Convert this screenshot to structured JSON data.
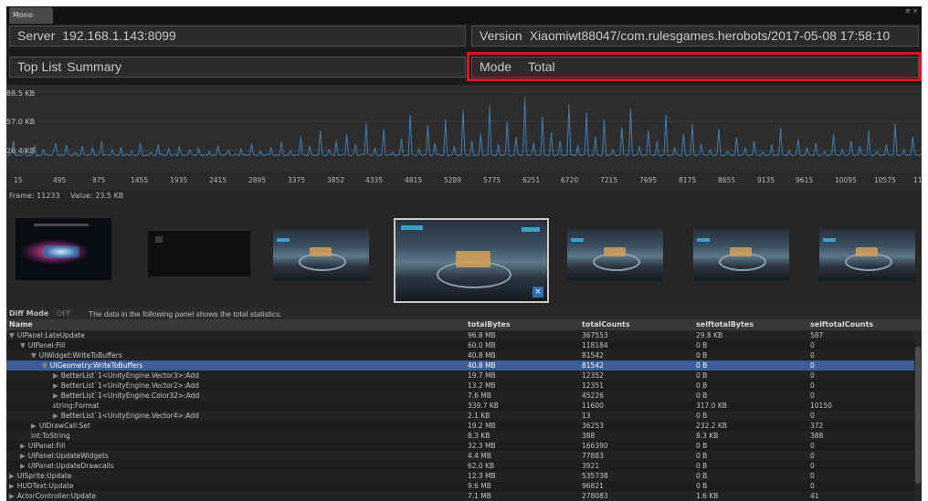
{
  "window": {
    "tab_title": "Mono",
    "buttons": "≡ ×"
  },
  "server": {
    "label": "Server",
    "value": "192.168.1.143:8099"
  },
  "version": {
    "label": "Version",
    "value": "Xiaomiwt88047/com.rulesgames.herobots/2017-05-08 17:58:10"
  },
  "toplist": {
    "label": "Top List",
    "value": "Summary"
  },
  "mode": {
    "label": "Mode",
    "value": "Total"
  },
  "chart_data": {
    "type": "line",
    "title": "",
    "ylabels": [
      "88.5 KB",
      "57.0 KB",
      "26.4 KB"
    ],
    "ylim": [
      0,
      88.5
    ],
    "x_ticks": [
      "15",
      "495",
      "975",
      "1455",
      "1935",
      "2415",
      "2895",
      "3375",
      "3852",
      "4335",
      "4815",
      "5289",
      "5775",
      "6251",
      "6720",
      "7215",
      "7695",
      "8175",
      "8655",
      "9135",
      "9615",
      "10095",
      "10575",
      "110"
    ],
    "line_color": "#3f7fb3",
    "values": [
      14,
      13,
      14,
      18,
      30,
      14,
      13,
      15,
      13,
      14,
      22,
      14,
      13,
      14,
      13,
      16,
      25,
      13,
      14,
      13,
      14,
      20,
      14,
      15,
      14,
      13,
      14,
      19,
      27,
      14,
      13,
      15,
      13,
      14,
      25,
      15,
      14,
      13,
      14,
      17,
      14,
      13,
      14,
      24,
      15,
      14,
      13,
      14,
      15,
      22,
      14,
      13,
      14,
      16,
      30,
      13,
      14,
      15,
      13,
      14,
      20,
      15,
      14,
      13,
      14,
      23,
      13,
      14,
      15,
      14,
      13,
      18,
      14,
      13,
      14,
      15,
      28,
      14,
      13,
      14,
      13,
      15,
      17,
      14,
      13,
      14,
      26,
      14,
      15,
      14,
      13,
      14,
      21,
      14,
      13,
      15,
      14,
      13,
      24,
      16,
      14,
      13,
      14,
      14,
      20,
      15,
      14,
      13,
      14,
      22,
      14,
      13,
      14,
      15,
      13,
      18,
      14,
      13,
      14,
      14,
      25,
      15,
      14,
      13,
      14,
      16,
      19,
      14,
      13,
      14,
      15,
      14,
      13,
      21,
      14,
      15,
      13,
      14,
      14,
      27,
      15,
      14,
      13,
      14,
      18,
      14,
      13,
      14,
      15,
      14,
      23,
      14,
      13,
      14,
      13,
      15,
      29,
      14,
      13,
      14,
      14,
      19,
      15,
      13,
      14,
      14,
      14,
      35,
      15,
      14,
      13,
      14,
      24,
      15,
      14,
      13,
      14,
      14,
      42,
      16,
      14,
      13,
      14,
      20,
      15,
      14,
      13,
      30,
      14,
      13,
      14,
      15,
      14,
      38,
      14,
      13,
      14,
      16,
      26,
      14,
      13,
      14,
      15,
      14,
      50,
      15,
      14,
      13,
      14,
      22,
      14,
      13,
      14,
      15,
      44,
      14,
      13,
      14,
      14,
      17,
      14,
      13,
      14,
      15,
      33,
      14,
      13,
      14,
      14,
      60,
      15,
      14,
      13,
      14,
      21,
      14,
      13,
      14,
      15,
      48,
      14,
      13,
      14,
      28,
      14,
      15,
      14,
      13,
      14,
      55,
      14,
      13,
      14,
      15,
      24,
      14,
      13,
      14,
      14,
      66,
      15,
      14,
      13,
      14,
      30,
      14,
      13,
      14,
      15,
      38,
      14,
      13,
      14,
      14,
      70,
      15,
      14,
      13,
      14,
      26,
      14,
      13,
      14,
      15,
      52,
      14,
      13,
      14,
      14,
      34,
      15,
      14,
      13,
      14,
      80,
      14,
      13,
      14,
      15,
      28,
      14,
      13,
      14,
      14,
      58,
      15,
      14,
      13,
      14,
      40,
      14,
      13,
      14,
      15,
      30,
      14,
      13,
      14,
      14,
      72,
      15,
      14,
      13,
      14,
      25,
      14,
      13,
      14,
      15,
      62,
      14,
      13,
      14,
      14,
      35,
      15,
      14,
      13,
      14,
      55,
      14,
      13,
      14,
      15,
      20,
      14,
      13,
      14,
      14,
      46,
      15,
      14,
      13,
      14,
      68,
      14,
      13,
      14,
      15,
      24,
      14,
      13,
      14,
      14,
      42,
      15,
      14,
      13,
      14,
      30,
      14,
      13,
      14,
      15,
      60,
      14,
      13,
      14,
      14,
      22,
      15,
      14,
      13,
      14,
      38,
      14,
      13,
      14,
      15,
      50,
      14,
      13,
      14,
      14,
      27,
      15,
      14,
      13,
      14,
      20,
      14,
      13,
      14,
      15,
      44,
      14,
      13,
      14,
      14,
      18,
      15,
      14,
      13,
      14,
      34,
      14,
      13,
      14,
      15,
      22,
      14,
      13,
      14,
      14,
      30,
      15,
      14,
      13,
      14,
      17,
      14,
      13,
      14,
      15,
      26,
      14,
      13,
      14,
      14,
      45,
      15,
      14,
      13,
      14,
      19,
      14,
      13,
      14,
      15,
      32,
      14,
      13,
      14,
      14,
      22,
      15,
      14,
      13,
      14,
      28,
      14,
      13,
      14,
      15,
      18,
      14,
      13,
      14,
      14,
      38,
      15,
      14,
      13,
      14,
      20,
      14,
      13,
      14,
      15,
      30,
      14,
      13,
      14,
      14,
      24,
      15,
      14,
      13,
      14,
      42,
      14,
      13,
      14,
      15,
      18,
      14,
      13,
      14,
      14,
      26,
      15,
      14,
      13,
      14,
      50,
      14,
      13,
      14,
      15,
      20,
      14,
      13,
      14,
      14,
      35,
      15,
      14,
      13,
      14,
      16
    ]
  },
  "frame_info": {
    "frame": "Frame: 11233",
    "value": "Value: 23.5 KB"
  },
  "diff": {
    "label": "Diff Mode",
    "state": "OFF",
    "message": "The data in the following panel shows the total statistics."
  },
  "table": {
    "columns": [
      "Name",
      "totalBytes",
      "totalCounts",
      "selftotalBytes",
      "selftotalCounts"
    ],
    "rows": [
      {
        "indent": 0,
        "arrow": "▼",
        "name": "UIPanel:LateUpdate",
        "totalBytes": "96.8 MB",
        "totalCounts": "367553",
        "selftotalBytes": "29.8 KB",
        "selftotalCounts": "587"
      },
      {
        "indent": 1,
        "arrow": "▼",
        "name": "UIPanel:Fill",
        "totalBytes": "60.0 MB",
        "totalCounts": "118184",
        "selftotalBytes": "0 B",
        "selftotalCounts": "0"
      },
      {
        "indent": 2,
        "arrow": "▼",
        "name": "UIWidget:WriteToBuffers",
        "totalBytes": "40.8 MB",
        "totalCounts": "81542",
        "selftotalBytes": "0 B",
        "selftotalCounts": "0"
      },
      {
        "indent": 3,
        "arrow": "▼",
        "name": "UIGeometry:WriteToBuffers",
        "totalBytes": "40.8 MB",
        "totalCounts": "81542",
        "selftotalBytes": "0 B",
        "selftotalCounts": "0",
        "selected": true
      },
      {
        "indent": 4,
        "arrow": "▶",
        "name": "BetterList`1<UnityEngine.Vector3>:Add",
        "totalBytes": "19.7 MB",
        "totalCounts": "12352",
        "selftotalBytes": "0 B",
        "selftotalCounts": "0"
      },
      {
        "indent": 4,
        "arrow": "▶",
        "name": "BetterList`1<UnityEngine.Vector2>:Add",
        "totalBytes": "13.2 MB",
        "totalCounts": "12351",
        "selftotalBytes": "0 B",
        "selftotalCounts": "0"
      },
      {
        "indent": 4,
        "arrow": "▶",
        "name": "BetterList`1<UnityEngine.Color32>:Add",
        "totalBytes": "7.6 MB",
        "totalCounts": "45226",
        "selftotalBytes": "0 B",
        "selftotalCounts": "0"
      },
      {
        "indent": 4,
        "arrow": "",
        "name": "string:Format",
        "totalBytes": "339.7 KB",
        "totalCounts": "11600",
        "selftotalBytes": "317.0 KB",
        "selftotalCounts": "10150"
      },
      {
        "indent": 4,
        "arrow": "▶",
        "name": "BetterList`1<UnityEngine.Vector4>:Add",
        "totalBytes": "2.1 KB",
        "totalCounts": "13",
        "selftotalBytes": "0 B",
        "selftotalCounts": "0"
      },
      {
        "indent": 2,
        "arrow": "▶",
        "name": "UIDrawCall:Set",
        "totalBytes": "19.2 MB",
        "totalCounts": "36253",
        "selftotalBytes": "232.2 KB",
        "selftotalCounts": "372"
      },
      {
        "indent": 2,
        "arrow": "",
        "name": "int:ToString",
        "totalBytes": "8.3 KB",
        "totalCounts": "388",
        "selftotalBytes": "8.3 KB",
        "selftotalCounts": "388"
      },
      {
        "indent": 1,
        "arrow": "▶",
        "name": "UIPanel:Fill",
        "totalBytes": "32.3 MB",
        "totalCounts": "166390",
        "selftotalBytes": "0 B",
        "selftotalCounts": "0"
      },
      {
        "indent": 1,
        "arrow": "▶",
        "name": "UIPanel:UpdateWidgets",
        "totalBytes": "4.4 MB",
        "totalCounts": "77883",
        "selftotalBytes": "0 B",
        "selftotalCounts": "0"
      },
      {
        "indent": 1,
        "arrow": "▶",
        "name": "UIPanel:UpdateDrawcalls",
        "totalBytes": "62.0 KB",
        "totalCounts": "3921",
        "selftotalBytes": "0 B",
        "selftotalCounts": "0"
      },
      {
        "indent": 0,
        "arrow": "▶",
        "name": "UISprite:Update",
        "totalBytes": "12.3 MB",
        "totalCounts": "535738",
        "selftotalBytes": "0 B",
        "selftotalCounts": "0"
      },
      {
        "indent": 0,
        "arrow": "▶",
        "name": "HUDText:Update",
        "totalBytes": "9.6 MB",
        "totalCounts": "96821",
        "selftotalBytes": "0 B",
        "selftotalCounts": "0"
      },
      {
        "indent": 0,
        "arrow": "▶",
        "name": "ActorController:Update",
        "totalBytes": "7.1 MB",
        "totalCounts": "278083",
        "selftotalBytes": "1.6 KB",
        "selftotalCounts": "41"
      }
    ]
  }
}
